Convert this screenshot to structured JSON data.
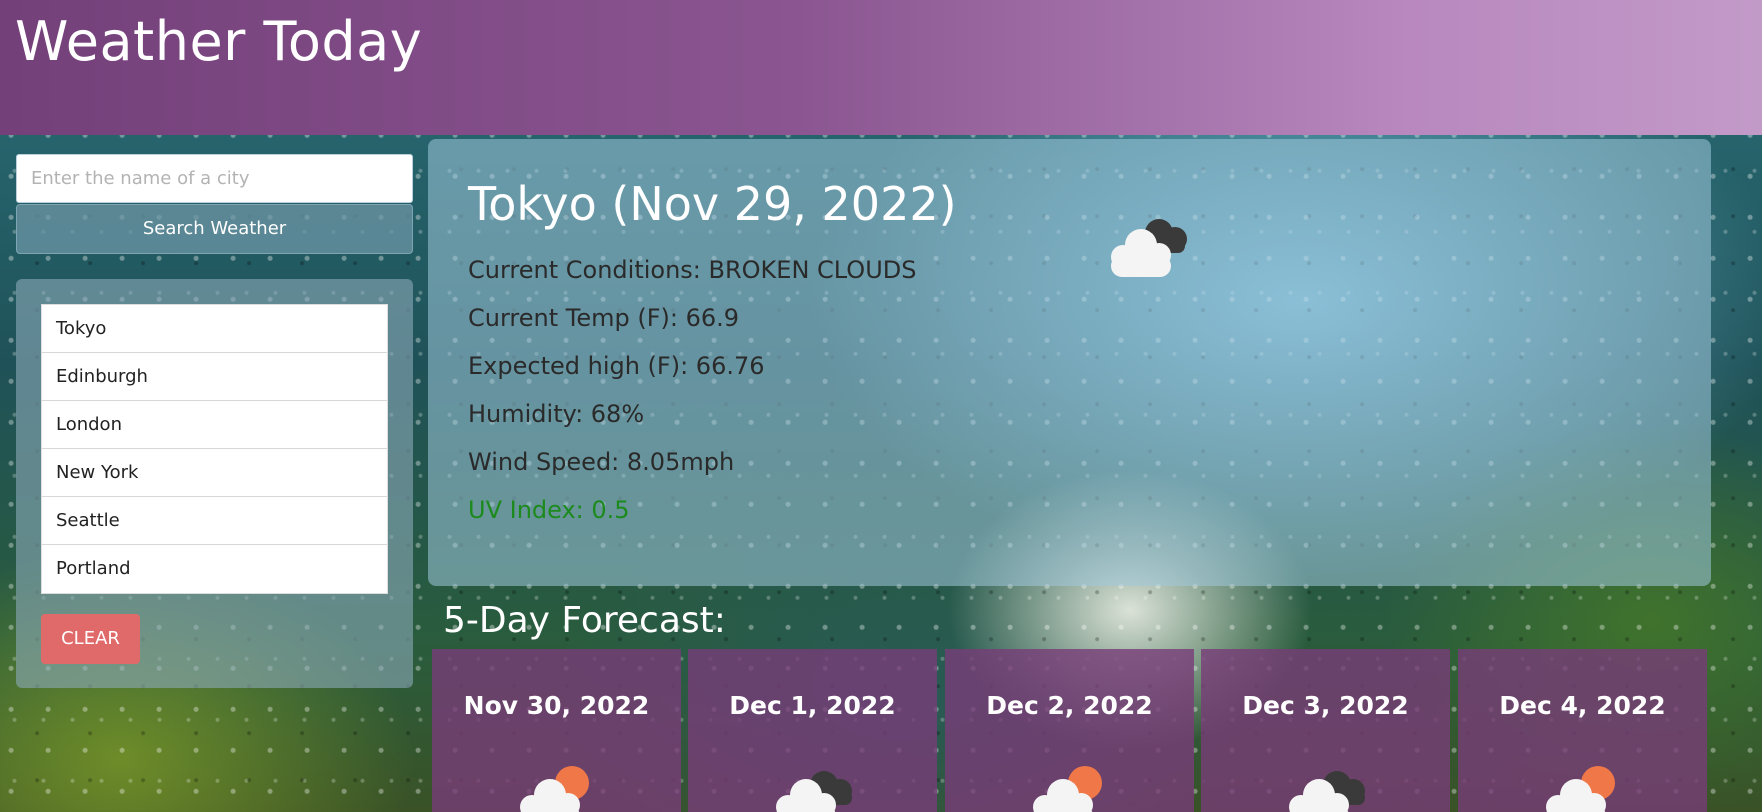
{
  "header": {
    "title": "Weather Today"
  },
  "search": {
    "placeholder": "Enter the name of a city",
    "value": "",
    "button_label": "Search Weather"
  },
  "history": {
    "cities": [
      "Tokyo",
      "Edinburgh",
      "London",
      "New York",
      "Seattle",
      "Portland"
    ],
    "clear_label": "CLEAR"
  },
  "current": {
    "title": "Tokyo (Nov 29, 2022)",
    "icon": "broken-clouds-icon",
    "conditions": "Current Conditions: BROKEN CLOUDS",
    "temp": "Current Temp (F): 66.9",
    "high": "Expected high (F): 66.76",
    "humidity": "Humidity: 68%",
    "wind": "Wind Speed: 8.05mph",
    "uv": "UV Index: 0.5",
    "uv_color": "#1c8a1c"
  },
  "forecast": {
    "heading": "5-Day Forecast:",
    "days": [
      {
        "date": "Nov 30, 2022",
        "icon": "partly-cloudy-icon"
      },
      {
        "date": "Dec 1, 2022",
        "icon": "broken-clouds-icon"
      },
      {
        "date": "Dec 2, 2022",
        "icon": "partly-cloudy-icon"
      },
      {
        "date": "Dec 3, 2022",
        "icon": "broken-clouds-icon"
      },
      {
        "date": "Dec 4, 2022",
        "icon": "partly-cloudy-icon"
      }
    ]
  },
  "colors": {
    "header_purple": "#8a5590",
    "card_purple": "#783c78",
    "clear_red": "#e06a6a"
  }
}
